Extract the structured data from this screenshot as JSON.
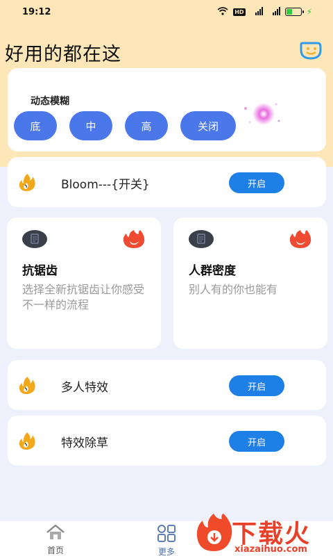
{
  "status_bar": {
    "time": "19:12",
    "hd_label": "HD",
    "signal_1": "4G",
    "signal_2": "4G"
  },
  "header": {
    "title": "好用的都在这"
  },
  "blur_section": {
    "label": "动态模糊",
    "options": [
      "底",
      "中",
      "高",
      "关闭"
    ]
  },
  "features": {
    "bloom": {
      "label": "Bloom---{开关}",
      "button": "开启"
    },
    "multi_effect": {
      "label": "多人特效",
      "button": "开启"
    },
    "weed_removal": {
      "label": "特效除草",
      "button": "开启"
    }
  },
  "cards": [
    {
      "title": "抗锯齿",
      "desc": "选择全新抗锯齿让你感受不一样的流程"
    },
    {
      "title": "人群密度",
      "desc": "别人有的你也能有"
    }
  ],
  "bottom_nav": {
    "home": "首页",
    "more": "更多"
  },
  "watermark": {
    "text": "下载火",
    "sub": "xiazaihuo.com"
  },
  "colors": {
    "accent": "#4a78ea",
    "toggle": "#1e7fe6",
    "header_bg": "#fde6b8"
  }
}
